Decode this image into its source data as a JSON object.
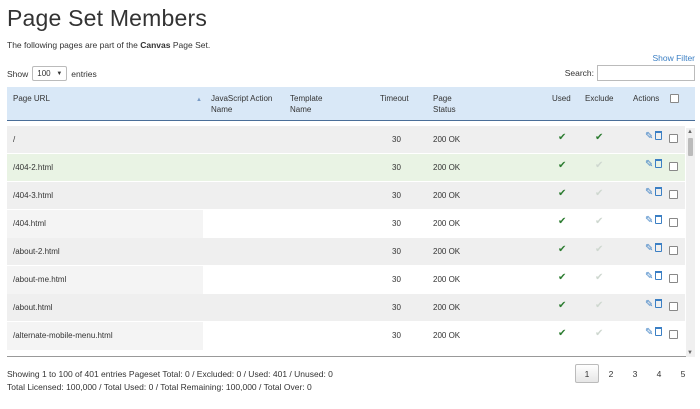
{
  "page": {
    "title": "Page Set Members",
    "subtitle_prefix": "The following pages are part of the ",
    "subtitle_bold": "Canvas",
    "subtitle_suffix": " Page Set.",
    "show_filter": "Show Filter"
  },
  "controls": {
    "show_label": "Show",
    "entries_value": "100",
    "entries_label": "entries",
    "search_label": "Search:",
    "search_value": ""
  },
  "columns": {
    "url": "Page URL",
    "js": "JavaScript Action Name",
    "template": "Template Name",
    "timeout": "Timeout",
    "status": "Page Status",
    "used": "Used",
    "exclude": "Exclude",
    "actions": "Actions"
  },
  "rows": [
    {
      "url": "/",
      "timeout": "30",
      "status": "200 OK",
      "used": true,
      "exclude": true
    },
    {
      "url": "/404-2.html",
      "timeout": "30",
      "status": "200 OK",
      "used": true,
      "exclude": false
    },
    {
      "url": "/404-3.html",
      "timeout": "30",
      "status": "200 OK",
      "used": true,
      "exclude": false
    },
    {
      "url": "/404.html",
      "timeout": "30",
      "status": "200 OK",
      "used": true,
      "exclude": false
    },
    {
      "url": "/about-2.html",
      "timeout": "30",
      "status": "200 OK",
      "used": true,
      "exclude": false
    },
    {
      "url": "/about-me.html",
      "timeout": "30",
      "status": "200 OK",
      "used": true,
      "exclude": false
    },
    {
      "url": "/about.html",
      "timeout": "30",
      "status": "200 OK",
      "used": true,
      "exclude": false
    },
    {
      "url": "/alternate-mobile-menu.html",
      "timeout": "30",
      "status": "200 OK",
      "used": true,
      "exclude": false
    }
  ],
  "footer": {
    "line1": "Showing 1 to 100 of 401 entries Pageset Total: 0 / Excluded: 0 / Used: 401 / Unused: 0",
    "line2": "Total Licensed: 100,000 / Total Used: 0 / Total Remaining: 100,000 / Total Over: 0"
  },
  "pagination": [
    "1",
    "2",
    "3",
    "4",
    "5"
  ],
  "colors": {
    "header_bg": "#d9e8f7",
    "link": "#3b7fc4",
    "check_green": "#2e7d32"
  }
}
